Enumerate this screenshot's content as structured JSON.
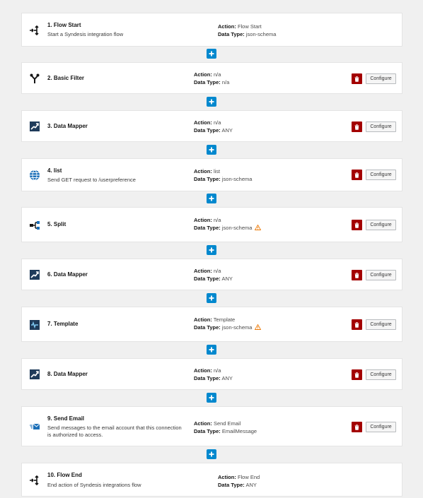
{
  "labels": {
    "action": "Action:",
    "data_type": "Data Type:"
  },
  "buttons": {
    "configure": "Configure"
  },
  "colors": {
    "delete": "#a30000",
    "add": "#0088ce",
    "warning": "#ec7a08"
  },
  "steps": [
    {
      "title": "1. Flow Start",
      "description": "Start a Syndesis integration flow",
      "action": "Flow Start",
      "data_type": "json-schema",
      "icon": "flow-start-icon"
    },
    {
      "title": "2. Basic Filter",
      "description": "",
      "action": "n/a",
      "data_type": "n/a",
      "icon": "filter-icon"
    },
    {
      "title": "3. Data Mapper",
      "description": "",
      "action": "n/a",
      "data_type": "ANY",
      "icon": "data-mapper-icon"
    },
    {
      "title": "4. list",
      "description": "Send GET request to /userpreference",
      "action": "list",
      "data_type": "json-schema",
      "icon": "api-globe-icon"
    },
    {
      "title": "5. Split",
      "description": "",
      "action": "n/a",
      "data_type": "json-schema",
      "icon": "split-icon",
      "warning": true
    },
    {
      "title": "6. Data Mapper",
      "description": "",
      "action": "n/a",
      "data_type": "ANY",
      "icon": "data-mapper-icon"
    },
    {
      "title": "7. Template",
      "description": "",
      "action": "Template",
      "data_type": "json-schema",
      "icon": "template-icon",
      "warning": true
    },
    {
      "title": "8. Data Mapper",
      "description": "",
      "action": "n/a",
      "data_type": "ANY",
      "icon": "data-mapper-icon"
    },
    {
      "title": "9. Send Email",
      "description": "Send messages to the email account that this connection is authorized to access.",
      "action": "Send Email",
      "data_type": "EmailMessage",
      "icon": "email-icon"
    },
    {
      "title": "10. Flow End",
      "description": "End action of Syndesis integrations flow",
      "action": "Flow End",
      "data_type": "ANY",
      "icon": "flow-end-icon"
    }
  ]
}
